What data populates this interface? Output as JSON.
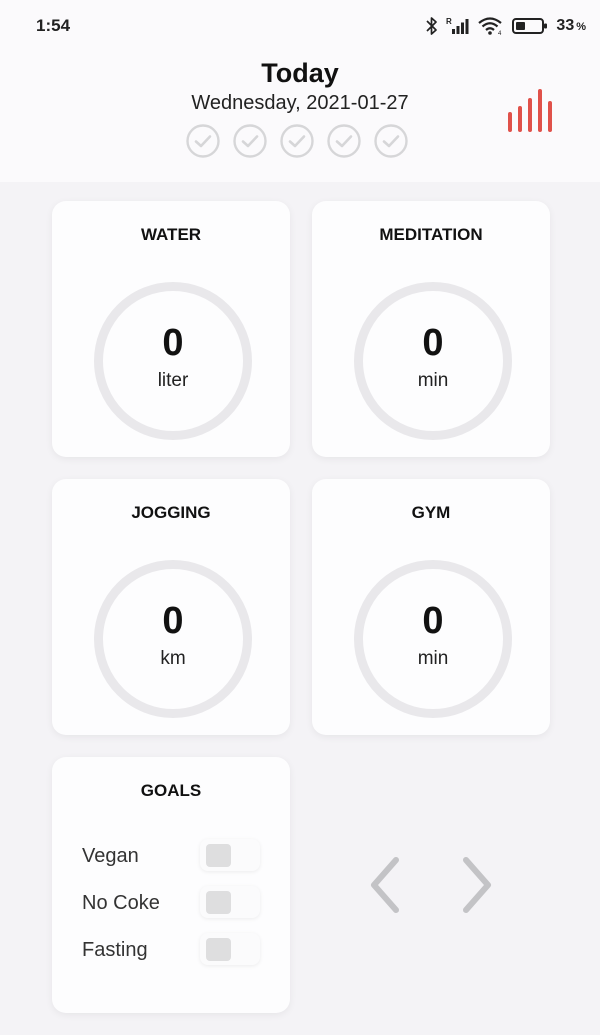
{
  "status_bar": {
    "time": "1:54",
    "battery_percent": "33",
    "percent_sign": "%",
    "icons": [
      "bluetooth-icon",
      "signal-icon",
      "wifi-icon",
      "battery-icon"
    ]
  },
  "header": {
    "title": "Today",
    "date": "Wednesday, 2021-01-27",
    "checks_count": 5,
    "stats_icon": "bar-chart-icon",
    "accent_color": "#e0514a"
  },
  "cards": [
    {
      "title": "WATER",
      "value": "0",
      "unit": "liter"
    },
    {
      "title": "MEDITATION",
      "value": "0",
      "unit": "min"
    },
    {
      "title": "JOGGING",
      "value": "0",
      "unit": "km"
    },
    {
      "title": "GYM",
      "value": "0",
      "unit": "min"
    }
  ],
  "goals": {
    "title": "GOALS",
    "items": [
      {
        "label": "Vegan",
        "enabled": false
      },
      {
        "label": "No Coke",
        "enabled": false
      },
      {
        "label": "Fasting",
        "enabled": false
      }
    ]
  },
  "navigation": {
    "prev_icon": "chevron-left-icon",
    "next_icon": "chevron-right-icon"
  }
}
